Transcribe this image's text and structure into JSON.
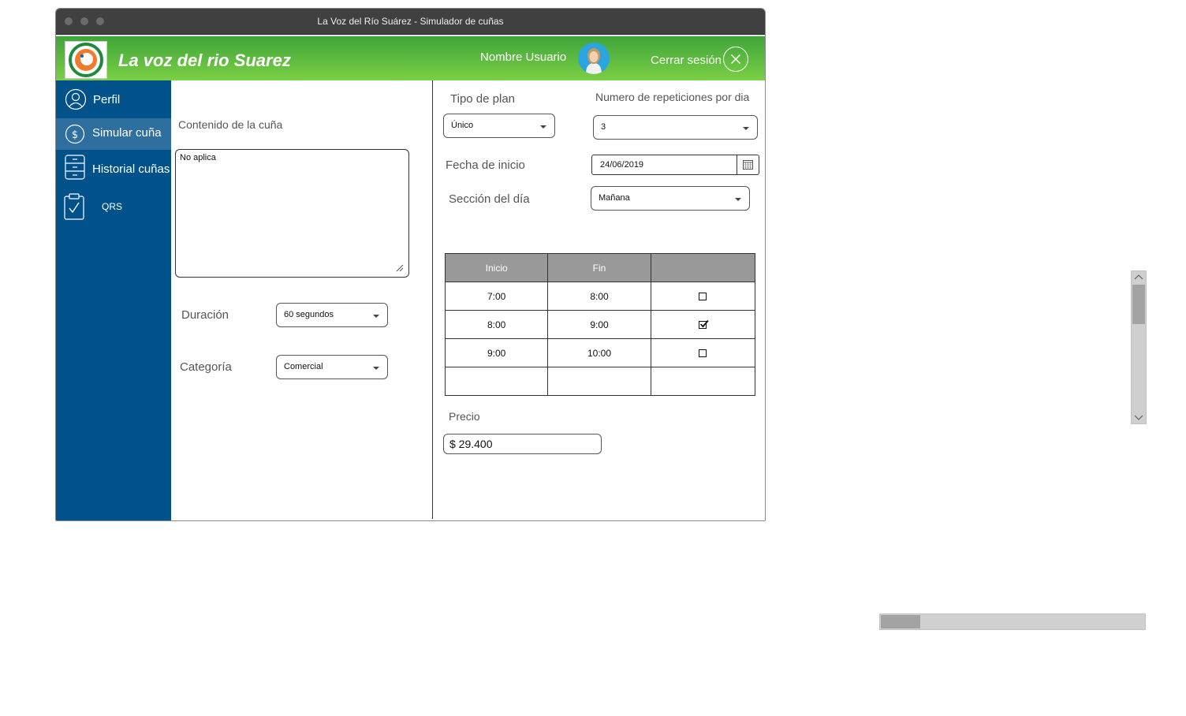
{
  "window": {
    "title": "La Voz del Río Suárez - Simulador de cuñas"
  },
  "header": {
    "app_title": "La voz del rio Suarez",
    "user_name": "Nombre Usuario",
    "logout_label": "Cerrar sesión"
  },
  "sidebar": {
    "items": [
      {
        "label": "Perfil",
        "icon": "user-icon"
      },
      {
        "label": "Simular cuña",
        "icon": "dollar-icon",
        "active": true
      },
      {
        "label": "Historial cuñas",
        "icon": "cabinet-icon"
      },
      {
        "label": "QRS",
        "icon": "clipboard-check-icon"
      }
    ]
  },
  "left_form": {
    "content_label": "Contenido de la cuña",
    "content_value": "No aplica",
    "duration_label": "Duración",
    "duration_value": "60 segundos",
    "category_label": "Categoría",
    "category_value": "Comercial"
  },
  "right_form": {
    "plan_label": "Tipo de plan",
    "plan_value": "Único",
    "repetitions_label": "Numero de repeticiones por dia",
    "repetitions_value": "3",
    "start_date_label": "Fecha de inicio",
    "start_date_value": "24/06/2019",
    "section_label": "Sección del día",
    "section_value": "Mañana",
    "price_label": "Precio",
    "price_value": "$ 29.400"
  },
  "schedule_table": {
    "headers": [
      "Inicio",
      "Fin",
      ""
    ],
    "rows": [
      {
        "start": "7:00",
        "end": "8:00",
        "checked": false
      },
      {
        "start": "8:00",
        "end": "9:00",
        "checked": true
      },
      {
        "start": "9:00",
        "end": "10:00",
        "checked": false
      },
      {
        "start": "",
        "end": "",
        "checked": null
      }
    ]
  },
  "colors": {
    "sidebar_bg": "#01528a",
    "sidebar_active": "#2f6f9f",
    "header_gradient_top": "#3fa43a",
    "header_gradient_bottom": "#7bd045",
    "table_header_bg": "#999999"
  }
}
